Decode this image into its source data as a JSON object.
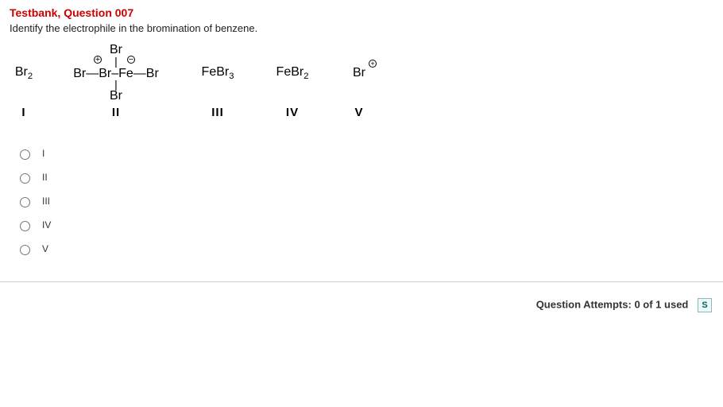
{
  "title": "Testbank, Question 007",
  "prompt": "Identify the electrophile in the bromination of benzene.",
  "structures": {
    "s1": {
      "label": "Br",
      "sub": "2",
      "roman": "I"
    },
    "s2": {
      "topBr": "Br",
      "bottomBr": "Br",
      "chain_left": "Br",
      "chain_mid1": "Br",
      "chain_center": "Fe",
      "chain_right": "Br",
      "pos_charge": "+",
      "neg_charge": "−",
      "roman": "II"
    },
    "s3": {
      "label": "FeBr",
      "sub": "3",
      "roman": "III"
    },
    "s4": {
      "label": "FeBr",
      "sub": "2",
      "roman": "IV"
    },
    "s5": {
      "label": "Br",
      "charge": "+",
      "roman": "V"
    }
  },
  "choices": [
    {
      "label": "I"
    },
    {
      "label": "II"
    },
    {
      "label": "III"
    },
    {
      "label": "IV"
    },
    {
      "label": "V"
    }
  ],
  "footer": {
    "attempts_label": "Question Attempts:",
    "attempts_value": "0 of 1 used",
    "save_initial": "S"
  }
}
